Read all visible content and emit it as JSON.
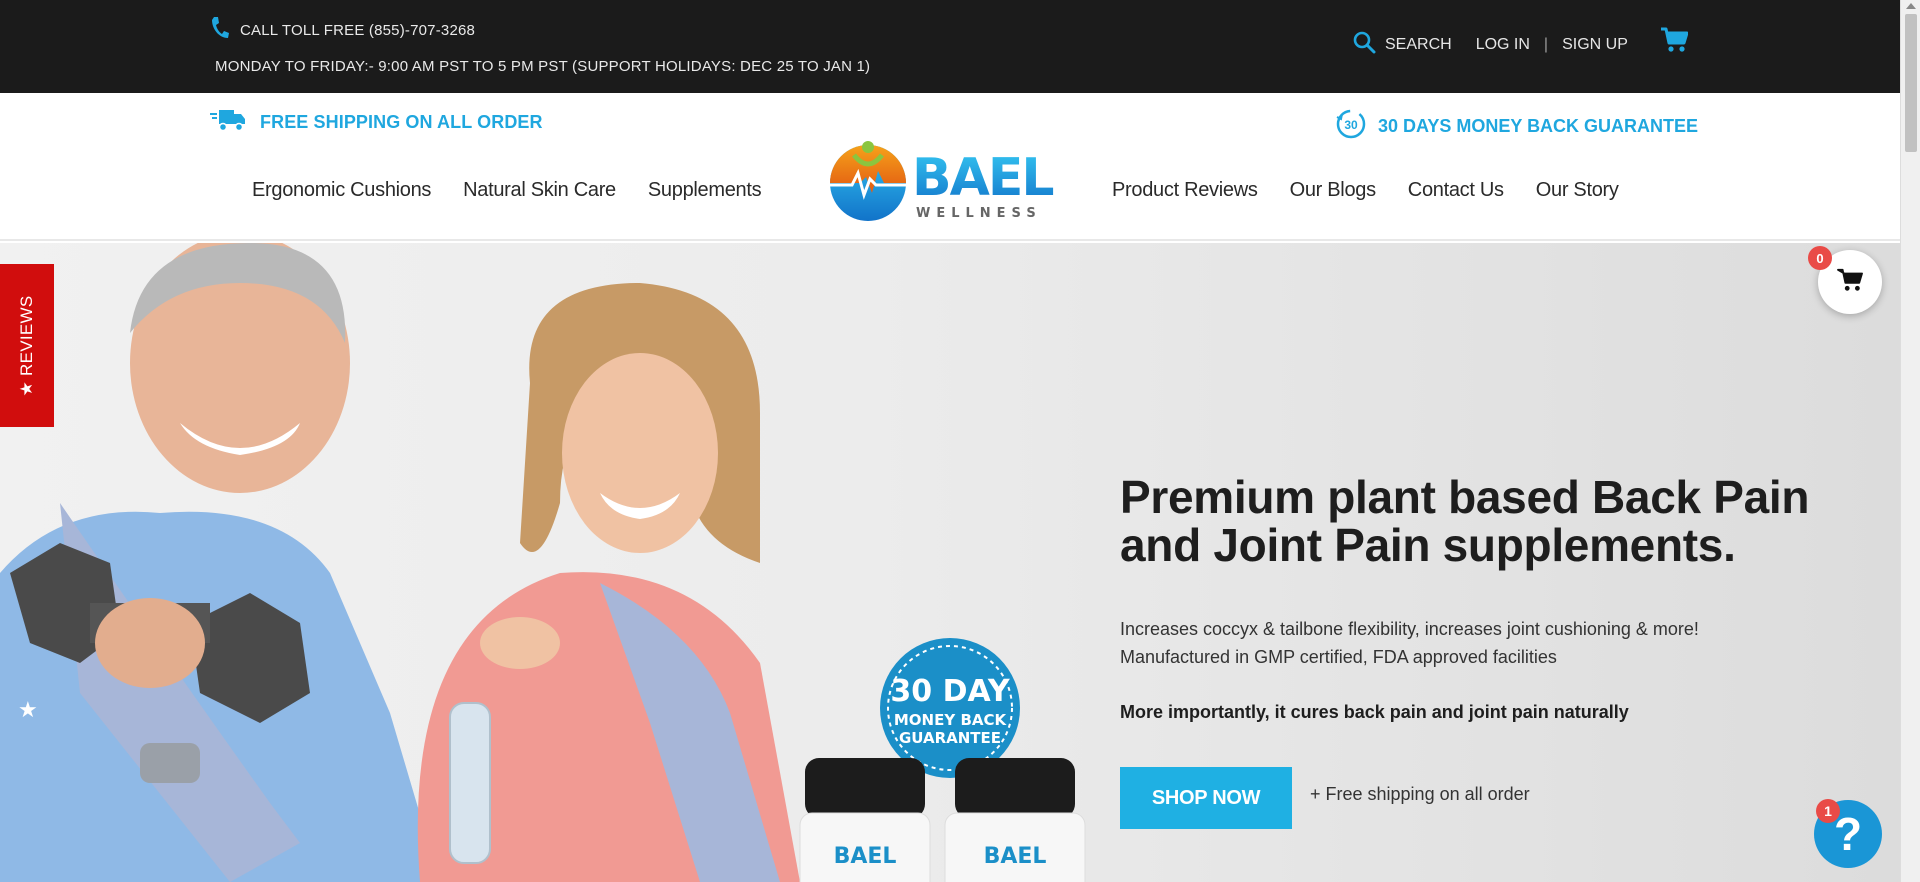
{
  "topbar": {
    "phone_text": "CALL TOLL FREE (855)-707-3268",
    "hours_text": "MONDAY TO FRIDAY:- 9:00 AM PST TO 5 PM PST (SUPPORT HOLIDAYS: DEC 25 TO JAN 1)",
    "search_label": "SEARCH",
    "login_label": "LOG IN",
    "separator": "|",
    "signup_label": "SIGN UP",
    "icons": [
      "phone-icon",
      "search-icon",
      "cart-icon"
    ]
  },
  "header": {
    "promo_left": "FREE SHIPPING ON ALL ORDER",
    "promo_right": "30 DAYS MONEY BACK GUARANTEE",
    "promo_right_badge": "30",
    "nav_left": [
      "Ergonomic Cushions",
      "Natural Skin Care",
      "Supplements"
    ],
    "nav_right": [
      "Product Reviews",
      "Our Blogs",
      "Contact Us",
      "Our Story"
    ],
    "logo": {
      "brand": "BAEL",
      "sub": "WELLNESS"
    }
  },
  "hero": {
    "title": "Premium plant based Back Pain and Joint Pain supplements.",
    "desc_line1": "Increases coccyx & tailbone flexibility, increases joint cushioning & more!",
    "desc_line2": "Manufactured in GMP certified, FDA approved facilities",
    "strong_text": "More importantly, it cures back pain and joint pain naturally",
    "cta_label": "SHOP NOW",
    "shipping_note": "+ Free shipping on all order",
    "image": {
      "seal_line1": "30 DAY",
      "seal_line2": "MONEY BACK",
      "seal_line3": "GUARANTEE",
      "bottle_label": "BAEL"
    }
  },
  "widgets": {
    "reviews_tab": "★ REVIEWS",
    "cart_badge": "0",
    "help_badge": "1",
    "help_glyph": "?"
  },
  "colors": {
    "topbar_bg": "#1b1b1b",
    "accent_blue": "#1fa7df",
    "button_blue": "#1fb0e3",
    "reviews_red": "#d10d0d",
    "badge_red": "#e94b47"
  }
}
